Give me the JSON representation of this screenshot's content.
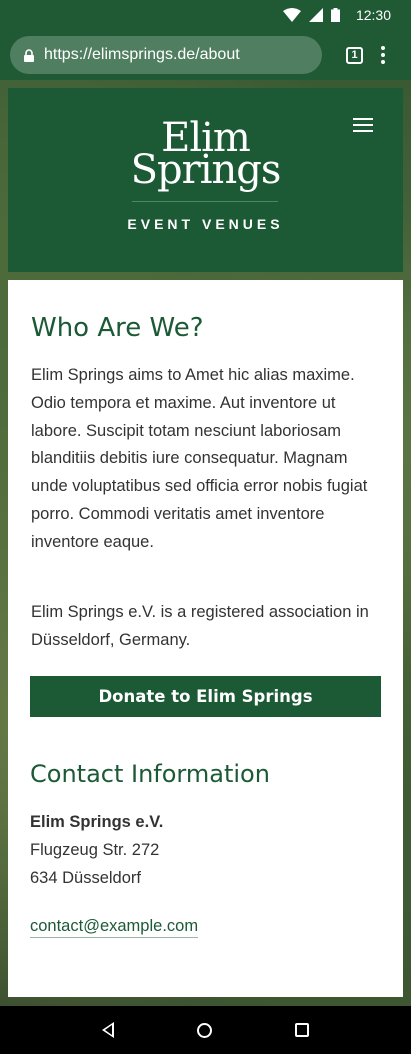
{
  "status_bar": {
    "time": "12:30"
  },
  "browser": {
    "url": "https://elimsprings.de/about",
    "tab_count": "1"
  },
  "header": {
    "logo_line1": "Elim",
    "logo_line2": "Springs",
    "logo_subtitle": "EVENT VENUES"
  },
  "about": {
    "title": "Who Are We?",
    "paragraph1": "Elim Springs aims to Amet hic alias maxime. Odio tempora et maxime. Aut inventore ut labore. Suscipit totam nesciunt laboriosam blanditiis debitis iure consequatur. Magnam unde voluptatibus sed officia error nobis fugiat porro. Commodi veritatis amet inventore inventore eaque.",
    "paragraph2": "Elim Springs e.V. is a registered association in Düsseldorf, Germany.",
    "donate_label": "Donate to Elim Springs"
  },
  "contact": {
    "title": "Contact Information",
    "org_name": "Elim Springs e.V.",
    "address_line1": "Flugzeug Str. 272",
    "address_line2": "634 Düsseldorf",
    "email": "contact@example.com"
  },
  "colors": {
    "brand_green": "#1c5a36",
    "text": "#333333"
  }
}
